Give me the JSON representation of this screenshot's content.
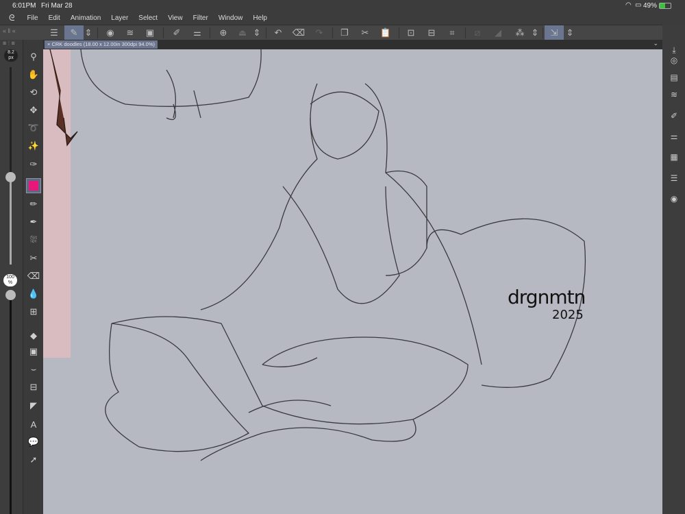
{
  "status": {
    "time": "6:01PM",
    "date": "Fri Mar 28",
    "battery": "49%"
  },
  "menu": [
    "File",
    "Edit",
    "Animation",
    "Layer",
    "Select",
    "View",
    "Filter",
    "Window",
    "Help"
  ],
  "document_tab": {
    "title": "CRK doodles (18.00 x 12.00in 300dpi 94.0%)"
  },
  "brush": {
    "size": "8.2",
    "size_unit": "px",
    "size_fraction": 0.4,
    "opacity": "100",
    "opacity_unit": "%",
    "opacity_fraction": 1.0
  },
  "colors": {
    "current": "#e8177a",
    "canvas": "#b6b8c2",
    "accent": "#6a7690"
  },
  "artwork": {
    "signature_name": "drgnmtn",
    "signature_year": "2025"
  },
  "tools": [
    "zoom-icon",
    "hand-icon",
    "rotate-icon",
    "move-icon",
    "lasso-icon",
    "magic-wand-icon",
    "eyedropper-icon",
    "color-swatch-icon",
    "pen-icon",
    "brush-icon",
    "airbrush-icon",
    "decoration-icon",
    "eraser-icon",
    "blend-icon",
    "grid-icon",
    "fill-icon",
    "gradient-icon",
    "vector-icon",
    "frame-icon",
    "ruler-icon",
    "text-icon",
    "balloon-icon",
    "correct-line-icon"
  ]
}
